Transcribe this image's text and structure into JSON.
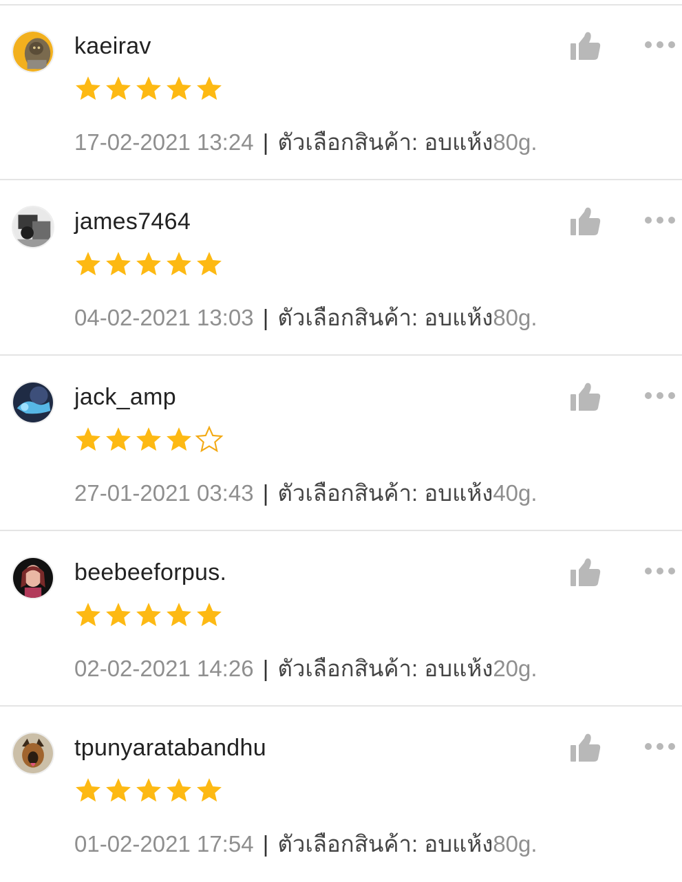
{
  "colors": {
    "star_fill": "#FDB913",
    "star_outline": "#F3A913",
    "text_primary": "#222222",
    "text_secondary": "#8F8F8F",
    "icon_gray": "#B8B8B8",
    "divider": "#E4E4E4"
  },
  "icons": {
    "like": "thumbs-up-icon",
    "more": "more-horizontal-icon",
    "star": "star-icon"
  },
  "reviews": [
    {
      "username": "kaeirav",
      "rating": 5,
      "date": "17-02-2021 13:24",
      "separator": "|",
      "variation_label": "ตัวเลือกสินค้า:",
      "variation_value": "อบแห้ง",
      "variation_size": "80g."
    },
    {
      "username": "james7464",
      "rating": 5,
      "date": "04-02-2021 13:03",
      "separator": "|",
      "variation_label": "ตัวเลือกสินค้า:",
      "variation_value": "อบแห้ง",
      "variation_size": "80g."
    },
    {
      "username": "jack_amp",
      "rating": 4,
      "date": "27-01-2021 03:43",
      "separator": "|",
      "variation_label": "ตัวเลือกสินค้า:",
      "variation_value": "อบแห้ง",
      "variation_size": "40g."
    },
    {
      "username": "beebeeforpus.",
      "rating": 5,
      "date": "02-02-2021 14:26",
      "separator": "|",
      "variation_label": "ตัวเลือกสินค้า:",
      "variation_value": "อบแห้ง",
      "variation_size": "20g."
    },
    {
      "username": "tpunyaratabandhu",
      "rating": 5,
      "date": "01-02-2021 17:54",
      "separator": "|",
      "variation_label": "ตัวเลือกสินค้า:",
      "variation_value": "อบแห้ง",
      "variation_size": "80g."
    }
  ]
}
